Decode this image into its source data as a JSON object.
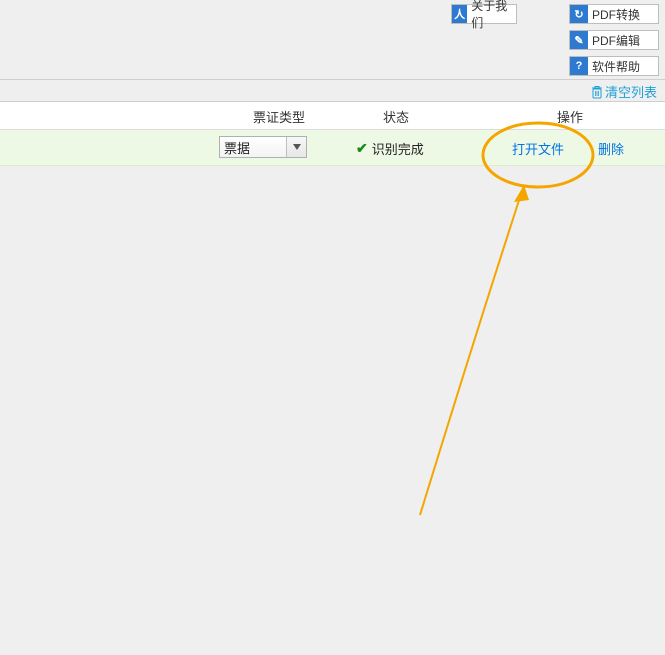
{
  "topbar": {
    "about": {
      "label": "关于我们",
      "icon": "person-icon",
      "glyph": "人"
    },
    "pdfconv": {
      "label": "PDF转换",
      "icon": "refresh-icon",
      "glyph": "↻"
    },
    "pdfedit": {
      "label": "PDF编辑",
      "icon": "edit-icon",
      "glyph": "✎"
    },
    "help": {
      "label": "软件帮助",
      "icon": "help-icon",
      "glyph": "?"
    }
  },
  "subbar": {
    "clear_list": "清空列表"
  },
  "table": {
    "headers": {
      "type": "票证类型",
      "status": "状态",
      "op": "操作"
    },
    "rows": [
      {
        "type_selected": "票据",
        "status_text": "识别完成",
        "status_ok": true,
        "open_label": "打开文件",
        "delete_label": "删除"
      }
    ]
  },
  "annotation": {
    "circle_target": "open-file-link",
    "color": "#f5a500"
  }
}
